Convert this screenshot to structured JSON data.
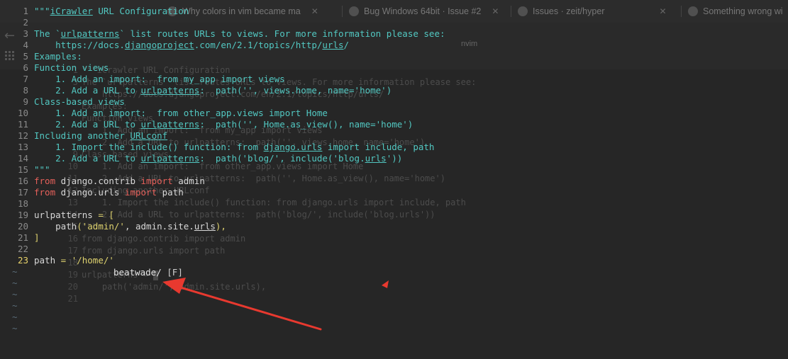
{
  "browser": {
    "tabs": [
      {
        "title": "Why colors in vim became ma"
      },
      {
        "title": "Bug Windows 64bit · Issue #2"
      },
      {
        "title": "Issues · zeit/hyper"
      },
      {
        "title": "Something wrong wi"
      }
    ],
    "nav_title": "nvim"
  },
  "ghost_editor": {
    "lines": [
      {
        "n": "1",
        "t": "\"\"\"iCrawler URL Configuration"
      },
      {
        "n": "3",
        "t": "The `urlpatterns` list routes URLs to views. For more information please see:"
      },
      {
        "n": "",
        "t": "    https://docs.djangoproject.com/en/2.1/topics/http/urls/"
      },
      {
        "n": "",
        "t": "Examples:"
      },
      {
        "n": "",
        "t": "Function views"
      },
      {
        "n": "",
        "t": "    1. Add an import:  from my_app import views"
      },
      {
        "n": "",
        "t": "    2. Add a URL to urlpatterns:  path('', views.home, name='home')"
      },
      {
        "n": "9",
        "t": "Class-based views"
      },
      {
        "n": "10",
        "t": "    1. Add an import:  from other_app.views import Home"
      },
      {
        "n": "11",
        "t": "    2. Add a URL to urlpatterns:  path('', Home.as_view(), name='home')"
      },
      {
        "n": "12",
        "t": "Including another URLconf"
      },
      {
        "n": "13",
        "t": "    1. Import the include() function: from django.urls import include, path"
      },
      {
        "n": "14",
        "t": "    2. Add a URL to urlpatterns:  path('blog/', include('blog.urls'))"
      },
      {
        "n": "15",
        "t": "\"\"\""
      },
      {
        "n": "16",
        "t": "from django.contrib import admin"
      },
      {
        "n": "17",
        "t": "from django.urls import path"
      },
      {
        "n": "18",
        "t": ""
      },
      {
        "n": "19",
        "t": "urlpatterns = "
      },
      {
        "n": "20",
        "t": "    path('admin/', admin.site.urls),"
      },
      {
        "n": "21",
        "t": ""
      }
    ]
  },
  "editor": {
    "current_line": "23",
    "lines": [
      {
        "n": "1",
        "parts": [
          [
            "c",
            "\"\"\""
          ],
          [
            "u",
            "iCrawler"
          ],
          [
            "c",
            " URL Configuration"
          ]
        ]
      },
      {
        "n": "2",
        "parts": []
      },
      {
        "n": "3",
        "parts": [
          [
            "c",
            "The `"
          ],
          [
            "u",
            "urlpatterns"
          ],
          [
            "c",
            "` list routes URLs to views. For more information please see:"
          ]
        ]
      },
      {
        "n": "4",
        "parts": [
          [
            "c",
            "    https://docs."
          ],
          [
            "u",
            "djangoproject"
          ],
          [
            "c",
            ".com/en/2.1/topics/http/"
          ],
          [
            "u",
            "urls"
          ],
          [
            "c",
            "/"
          ]
        ]
      },
      {
        "n": "5",
        "parts": [
          [
            "c",
            "Examples:"
          ]
        ]
      },
      {
        "n": "6",
        "parts": [
          [
            "c",
            "Function views"
          ]
        ]
      },
      {
        "n": "7",
        "parts": [
          [
            "c",
            "    1. Add an import:  from my_app import views"
          ]
        ]
      },
      {
        "n": "8",
        "parts": [
          [
            "c",
            "    2. Add a URL to "
          ],
          [
            "u",
            "urlpatterns"
          ],
          [
            "c",
            ":  path('', views.home, name='home')"
          ]
        ]
      },
      {
        "n": "9",
        "parts": [
          [
            "c",
            "Class-based views"
          ]
        ]
      },
      {
        "n": "10",
        "parts": [
          [
            "c",
            "    1. Add an import:  from other_app.views import Home"
          ]
        ]
      },
      {
        "n": "11",
        "parts": [
          [
            "c",
            "    2. Add a URL to "
          ],
          [
            "u",
            "urlpatterns"
          ],
          [
            "c",
            ":  path('', Home.as_view(), name='home')"
          ]
        ]
      },
      {
        "n": "12",
        "parts": [
          [
            "c",
            "Including another "
          ],
          [
            "u",
            "URLconf"
          ]
        ]
      },
      {
        "n": "13",
        "parts": [
          [
            "c",
            "    1. Import the include() function: from "
          ],
          [
            "u",
            "django.urls"
          ],
          [
            "c",
            " import include, path"
          ]
        ]
      },
      {
        "n": "14",
        "parts": [
          [
            "c",
            "    2. Add a URL to "
          ],
          [
            "u",
            "urlpatterns"
          ],
          [
            "c",
            ":  path('blog/', include('blog."
          ],
          [
            "u",
            "urls"
          ],
          [
            "c",
            "'))"
          ]
        ]
      },
      {
        "n": "15",
        "parts": [
          [
            "c",
            "\"\"\""
          ]
        ]
      },
      {
        "n": "16",
        "parts": [
          [
            "kw",
            "from"
          ],
          [
            "w",
            " django.contrib "
          ],
          [
            "kw",
            "import"
          ],
          [
            "w",
            " admin"
          ]
        ]
      },
      {
        "n": "17",
        "parts": [
          [
            "kw",
            "from"
          ],
          [
            "w",
            " django.urls "
          ],
          [
            "kw",
            "import"
          ],
          [
            "w",
            " path"
          ]
        ]
      },
      {
        "n": "18",
        "parts": []
      },
      {
        "n": "19",
        "parts": [
          [
            "w",
            "urlpatterns "
          ],
          [
            "s",
            "="
          ],
          [
            "w",
            " "
          ],
          [
            "s",
            "["
          ]
        ]
      },
      {
        "n": "20",
        "parts": [
          [
            "w",
            "    path"
          ],
          [
            "s",
            "('admin/'"
          ],
          [
            "w",
            ", admin.site."
          ],
          [
            "u-w",
            "urls"
          ],
          [
            "s",
            "),"
          ]
        ]
      },
      {
        "n": "21",
        "parts": [
          [
            "s",
            "]"
          ]
        ]
      },
      {
        "n": "22",
        "parts": []
      },
      {
        "n": "23",
        "parts": [
          [
            "w",
            "path "
          ],
          [
            "s",
            "="
          ],
          [
            "w",
            " "
          ],
          [
            "s",
            "'/home/'"
          ]
        ]
      }
    ],
    "tilde_count": 6,
    "tilde_char": "~"
  },
  "completion": {
    "item": "beatwade/",
    "kind": "[F]"
  },
  "colors": {
    "annotation_arrow": "#e8392f"
  }
}
